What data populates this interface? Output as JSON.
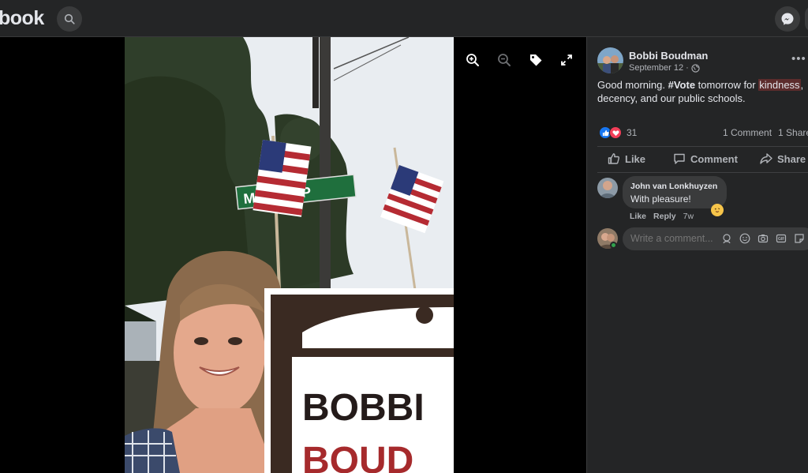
{
  "header": {
    "logo_text": "book",
    "search_icon": "search-icon",
    "messenger_icon": "messenger-icon"
  },
  "viewer": {
    "tools": [
      "zoom-in-icon",
      "zoom-out-icon",
      "tag-icon",
      "fullscreen-icon"
    ],
    "photo": {
      "street_sign_text": "McM   Rd  P",
      "yard_sign_line1": "BOBBI",
      "yard_sign_line2": "BOUD"
    }
  },
  "post": {
    "author": "Bobbi Boudman",
    "date": "September 12",
    "separator": "·",
    "audience_icon": "globe-icon",
    "more_label": "•••",
    "text_before": "Good morning. ",
    "hashtag": "#Vote",
    "text_mid": " tomorrow for ",
    "highlight": "kindness",
    "text_after": ", decency, and our public schools.",
    "reaction_count": "31",
    "comments_count": "1 Comment",
    "shares_count": "1 Share"
  },
  "actions": {
    "like": "Like",
    "comment": "Comment",
    "share": "Share"
  },
  "comment": {
    "author": "John van Lonkhuyzen",
    "text": "With pleasure!",
    "like": "Like",
    "reply": "Reply",
    "time": "7w"
  },
  "composer": {
    "placeholder": "Write a comment..."
  },
  "colors": {
    "panel_bg": "#242526",
    "bubble_bg": "#3a3b3c",
    "like_blue": "#1877f2",
    "love_red": "#f33e58",
    "highlight_bg": "#5c2c2c"
  }
}
